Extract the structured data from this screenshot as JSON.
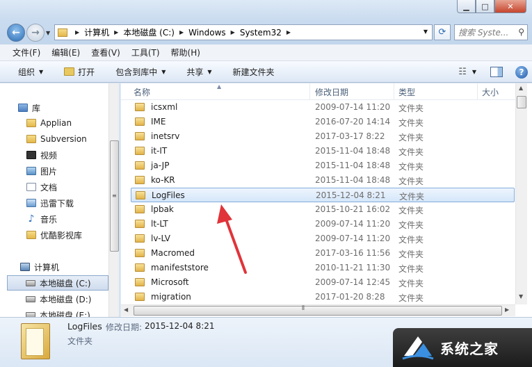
{
  "window": {
    "minimize_glyph": "▁",
    "maximize_glyph": "□",
    "close_glyph": "✕"
  },
  "address": {
    "crumbs": [
      "计算机",
      "本地磁盘 (C:)",
      "Windows",
      "System32"
    ],
    "search_placeholder": "搜索 Syste..."
  },
  "menu": {
    "items": [
      "文件(F)",
      "编辑(E)",
      "查看(V)",
      "工具(T)",
      "帮助(H)"
    ]
  },
  "toolbar": {
    "organize": "组织",
    "open": "打开",
    "include": "包含到库中",
    "share": "共享",
    "new_folder": "新建文件夹"
  },
  "nav": {
    "items": [
      {
        "label": "库",
        "icon": "library-icon"
      },
      {
        "label": "Applian",
        "icon": "folder-icon"
      },
      {
        "label": "Subversion",
        "icon": "folder-icon"
      },
      {
        "label": "视频",
        "icon": "video-icon"
      },
      {
        "label": "图片",
        "icon": "picture-icon"
      },
      {
        "label": "文档",
        "icon": "document-icon"
      },
      {
        "label": "迅雷下载",
        "icon": "download-icon"
      },
      {
        "label": "音乐",
        "icon": "music-icon"
      },
      {
        "label": "优酷影视库",
        "icon": "folder-icon"
      },
      {
        "label": "计算机",
        "icon": "computer-icon"
      },
      {
        "label": "本地磁盘 (C:)",
        "icon": "drive-icon"
      },
      {
        "label": "本地磁盘 (D:)",
        "icon": "drive-icon"
      },
      {
        "label": "本地磁盘 (E:)",
        "icon": "drive-icon"
      }
    ]
  },
  "columns": {
    "name": "名称",
    "date": "修改日期",
    "type": "类型",
    "size": "大小"
  },
  "files": [
    {
      "name": "icsxml",
      "date": "2009-07-14 11:20",
      "type": "文件夹"
    },
    {
      "name": "IME",
      "date": "2016-07-20 14:14",
      "type": "文件夹"
    },
    {
      "name": "inetsrv",
      "date": "2017-03-17 8:22",
      "type": "文件夹"
    },
    {
      "name": "it-IT",
      "date": "2015-11-04 18:48",
      "type": "文件夹"
    },
    {
      "name": "ja-JP",
      "date": "2015-11-04 18:48",
      "type": "文件夹"
    },
    {
      "name": "ko-KR",
      "date": "2015-11-04 18:48",
      "type": "文件夹"
    },
    {
      "name": "LogFiles",
      "date": "2015-12-04 8:21",
      "type": "文件夹"
    },
    {
      "name": "lpbak",
      "date": "2015-10-21 16:02",
      "type": "文件夹"
    },
    {
      "name": "lt-LT",
      "date": "2009-07-14 11:20",
      "type": "文件夹"
    },
    {
      "name": "lv-LV",
      "date": "2009-07-14 11:20",
      "type": "文件夹"
    },
    {
      "name": "Macromed",
      "date": "2017-03-16 11:56",
      "type": "文件夹"
    },
    {
      "name": "manifeststore",
      "date": "2010-11-21 11:30",
      "type": "文件夹"
    },
    {
      "name": "Microsoft",
      "date": "2009-07-14 12:45",
      "type": "文件夹"
    },
    {
      "name": "migration",
      "date": "2017-01-20 8:28",
      "type": "文件夹"
    }
  ],
  "selected_file_index": 6,
  "details": {
    "name": "LogFiles",
    "modified_label": "修改日期:",
    "modified_value": "2015-12-04 8:21",
    "type": "文件夹"
  },
  "watermark": {
    "text": "系统之家"
  },
  "colors": {
    "annotation_arrow": "#e0343a",
    "selection_border": "#84acdd"
  }
}
